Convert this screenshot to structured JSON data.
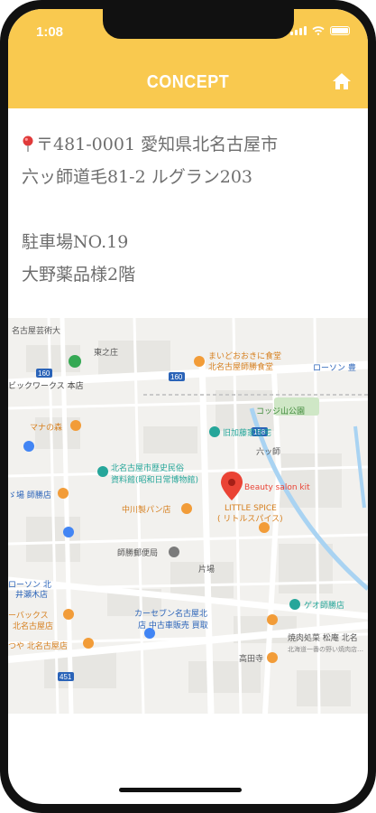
{
  "status_bar": {
    "time": "1:08"
  },
  "header": {
    "title": "CONCEPT",
    "home_icon": "home-icon"
  },
  "address": {
    "line1": "〒481-0001 愛知県北名古屋市",
    "line2": "六ッ師道毛81-2 ルグラン203",
    "line3": "駐車場NO.19",
    "line4": "大野薬品様2階",
    "pin_icon": "map-pin-icon"
  },
  "map": {
    "labels": {
      "geijutsu": "名古屋芸術大",
      "higashiyuki": "東之庄",
      "ichi_worx": "ビックワークス 本店",
      "maido": "まいどおおきに食堂",
      "maido2": "北名古屋師勝食堂",
      "lawson1": "ローソン 豊",
      "kotsuji": "コッジ山公園",
      "route160": "160",
      "route158": "158",
      "mana": "マナの森",
      "kyu_fujii": "旧加藤家住宅",
      "rokushi": "六ッ師",
      "museum1": "北名古屋市歴史民俗",
      "museum2": "資料館(昭和日常博物館)",
      "beauty": "Beauty salon kit",
      "spice1": "LITTLE SPICE",
      "spice2": "( リトルスパイス)",
      "nakagawa": "中川製パン店",
      "shikatsu_post": "師勝郵便局",
      "shikatsu_store": "ゞ場 師勝店",
      "katabata": "片場",
      "lawson2": "ローソン 北",
      "lawson2b": "井瀬木店",
      "carseven1": "カーセブン名古屋北",
      "carseven2": "店 中古車販売 買取",
      "geo": "ゲオ師勝店",
      "backs1": "ーバックス",
      "backs2": "北名古屋店",
      "tsuya": "つや 北名古屋店",
      "yakiniku": "焼肉処菜 松庵 北名",
      "yakiniku2": "北海道一番の野い焼肉店…",
      "takadaji": "高田寺",
      "route451": "451"
    }
  }
}
